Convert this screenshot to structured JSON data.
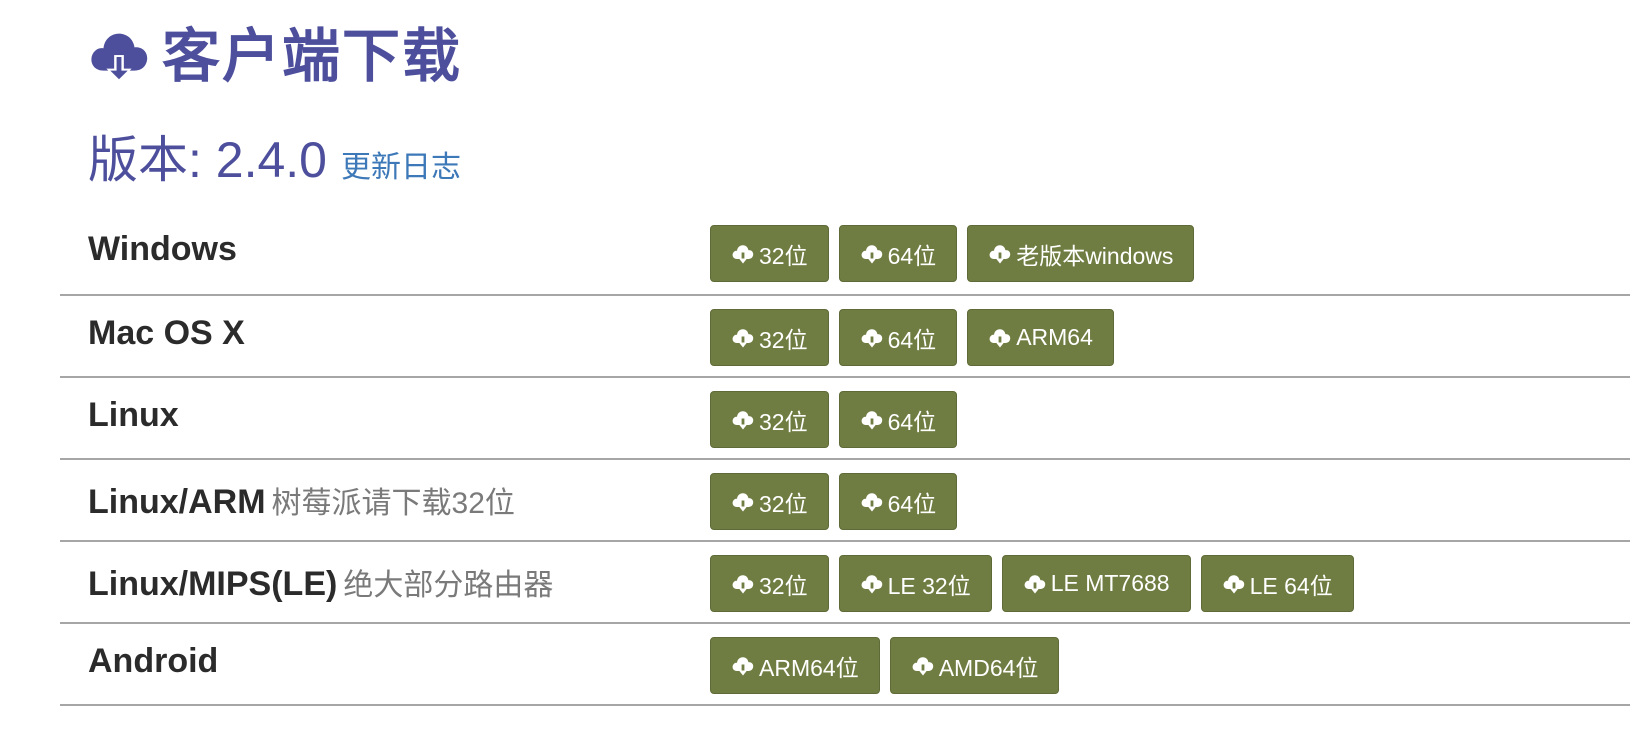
{
  "header": {
    "title": "客户端下载",
    "version_label": "版本: 2.4.0",
    "changelog_link": "更新日志"
  },
  "theme": {
    "title_color": "#4d4f9d",
    "link_color": "#3d78b8",
    "button_color": "#6f7d42",
    "divider_color": "#a6a6a6"
  },
  "icons": {
    "title_icon": "cloud-download-icon",
    "button_icon": "cloud-download-icon"
  },
  "platforms": [
    {
      "name": "Windows",
      "note": "",
      "buttons": [
        "32位",
        "64位",
        "老版本windows"
      ]
    },
    {
      "name": "Mac OS X",
      "note": "",
      "buttons": [
        "32位",
        "64位",
        "ARM64"
      ]
    },
    {
      "name": "Linux",
      "note": "",
      "buttons": [
        "32位",
        "64位"
      ]
    },
    {
      "name": "Linux/ARM",
      "note": "树莓派请下载32位",
      "buttons": [
        "32位",
        "64位"
      ]
    },
    {
      "name": "Linux/MIPS(LE)",
      "note": "绝大部分路由器",
      "buttons": [
        "32位",
        "LE 32位",
        "LE MT7688",
        "LE 64位"
      ]
    },
    {
      "name": "Android",
      "note": "",
      "buttons": [
        "ARM64位",
        "AMD64位"
      ]
    }
  ]
}
